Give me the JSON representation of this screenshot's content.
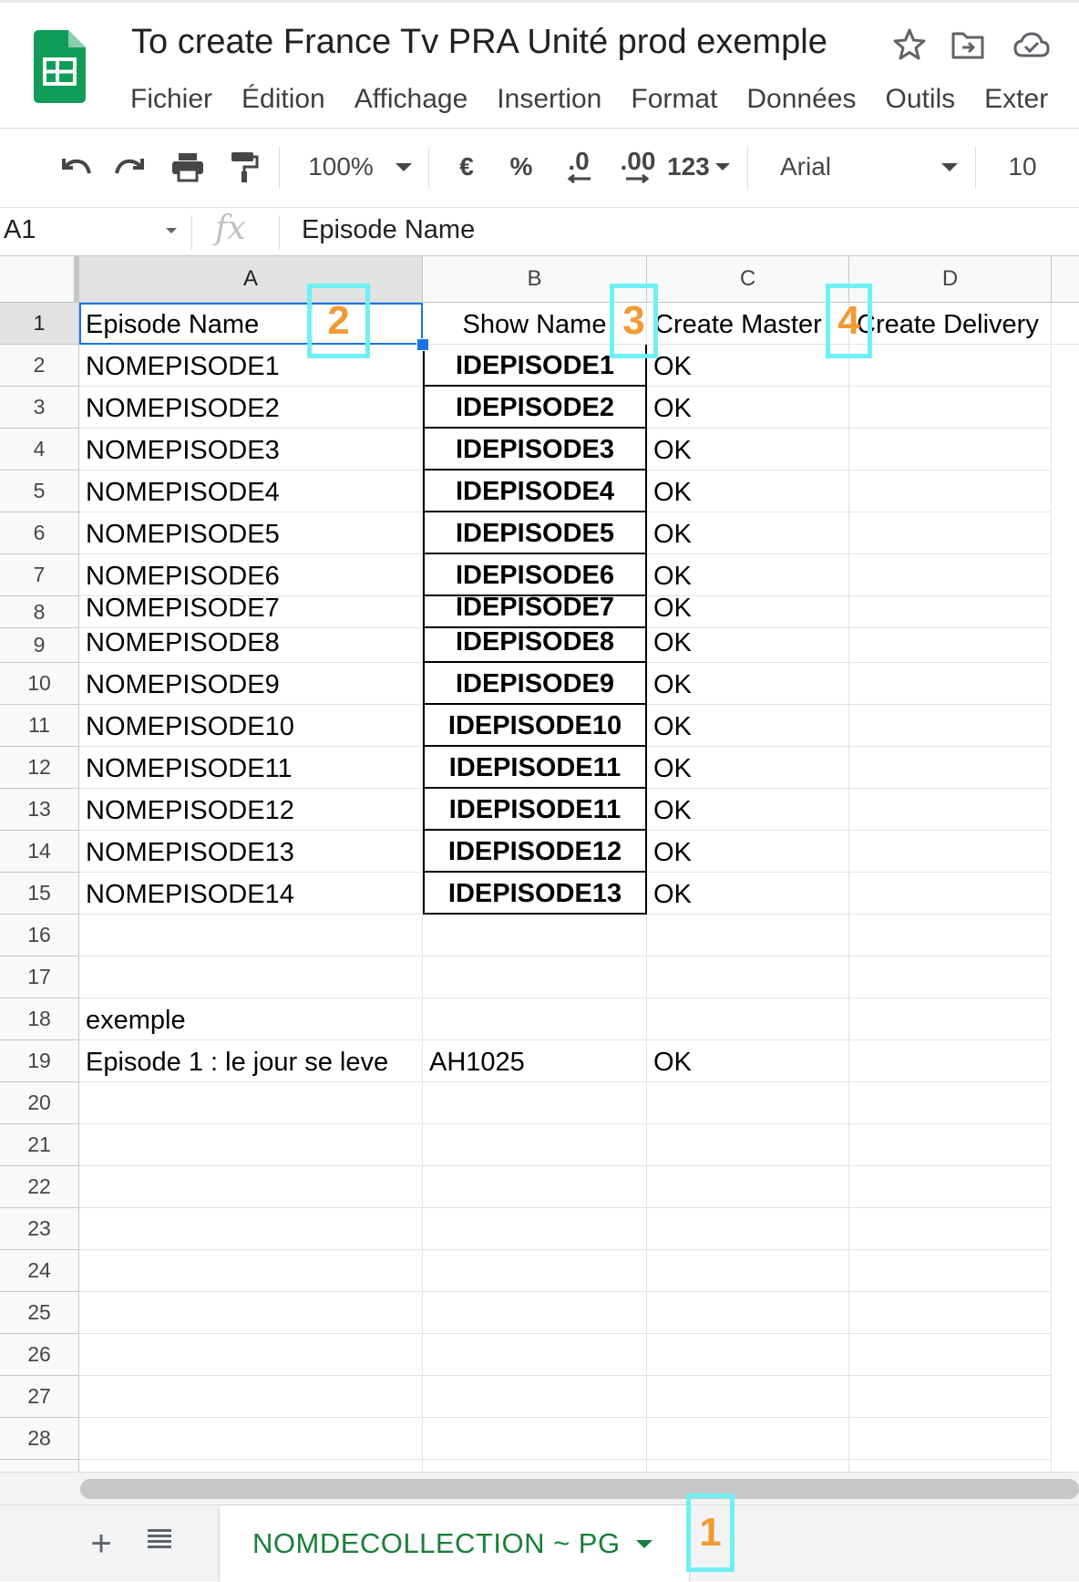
{
  "app": {
    "title": "To create France Tv PRA Unité prod exemple",
    "icons": {
      "star": "star-icon",
      "move": "move-to-folder-icon",
      "cloud": "cloud-status-icon",
      "logo": "sheets-logo-icon"
    }
  },
  "menu": [
    "Fichier",
    "Édition",
    "Affichage",
    "Insertion",
    "Format",
    "Données",
    "Outils",
    "Exter"
  ],
  "toolbar": {
    "zoom": "100%",
    "currency": "€",
    "percent": "%",
    "decrease_decimals": ".0",
    "increase_decimals": ".00",
    "number_format": "123",
    "font": "Arial",
    "font_size": "10"
  },
  "formula_bar": {
    "cell_ref": "A1",
    "fx": "fx",
    "content": "Episode Name"
  },
  "columns": [
    "A",
    "B",
    "C",
    "D"
  ],
  "rows": [
    "1",
    "2",
    "3",
    "4",
    "5",
    "6",
    "7",
    "8",
    "9",
    "10",
    "11",
    "12",
    "13",
    "14",
    "15",
    "16",
    "17",
    "18",
    "19",
    "20",
    "21",
    "22",
    "23",
    "24",
    "25",
    "26",
    "27",
    "28"
  ],
  "cells": {
    "header": {
      "a": "Episode Name",
      "b": "Show Name",
      "c": "Create Master",
      "d": "Create Delivery"
    },
    "episodes": [
      {
        "a": "NOMEPISODE1",
        "b": "IDEPISODE1",
        "c": "OK"
      },
      {
        "a": "NOMEPISODE2",
        "b": "IDEPISODE2",
        "c": "OK"
      },
      {
        "a": "NOMEPISODE3",
        "b": "IDEPISODE3",
        "c": "OK"
      },
      {
        "a": "NOMEPISODE4",
        "b": "IDEPISODE4",
        "c": "OK"
      },
      {
        "a": "NOMEPISODE5",
        "b": "IDEPISODE5",
        "c": "OK"
      },
      {
        "a": "NOMEPISODE6",
        "b": "IDEPISODE6",
        "c": "OK"
      },
      {
        "a": "NOMEPISODE7",
        "b": "IDEPISODE7",
        "c": "OK"
      },
      {
        "a": "NOMEPISODE8",
        "b": "IDEPISODE8",
        "c": "OK"
      },
      {
        "a": "NOMEPISODE9",
        "b": "IDEPISODE9",
        "c": "OK"
      },
      {
        "a": "NOMEPISODE10",
        "b": "IDEPISODE10",
        "c": "OK"
      },
      {
        "a": "NOMEPISODE11",
        "b": "IDEPISODE11",
        "c": "OK"
      },
      {
        "a": "NOMEPISODE12",
        "b": "IDEPISODE11",
        "c": "OK"
      },
      {
        "a": "NOMEPISODE13",
        "b": "IDEPISODE12",
        "c": "OK"
      },
      {
        "a": "NOMEPISODE14",
        "b": "IDEPISODE13",
        "c": "OK"
      }
    ],
    "example_label": "exemple",
    "example_row": {
      "a": "Episode 1 : le jour se leve",
      "b": "AH1025",
      "c": "OK"
    }
  },
  "callouts": {
    "one": "1",
    "two": "2",
    "three": "3",
    "four": "4"
  },
  "callout_color": "#6ff0f5",
  "callout_text_color": "#f09a33",
  "sheet_tab": {
    "label": "NOMDECOLLECTION ~ PG",
    "color": "#188038"
  },
  "sheet_controls": {
    "add": "+",
    "list": "≡"
  }
}
